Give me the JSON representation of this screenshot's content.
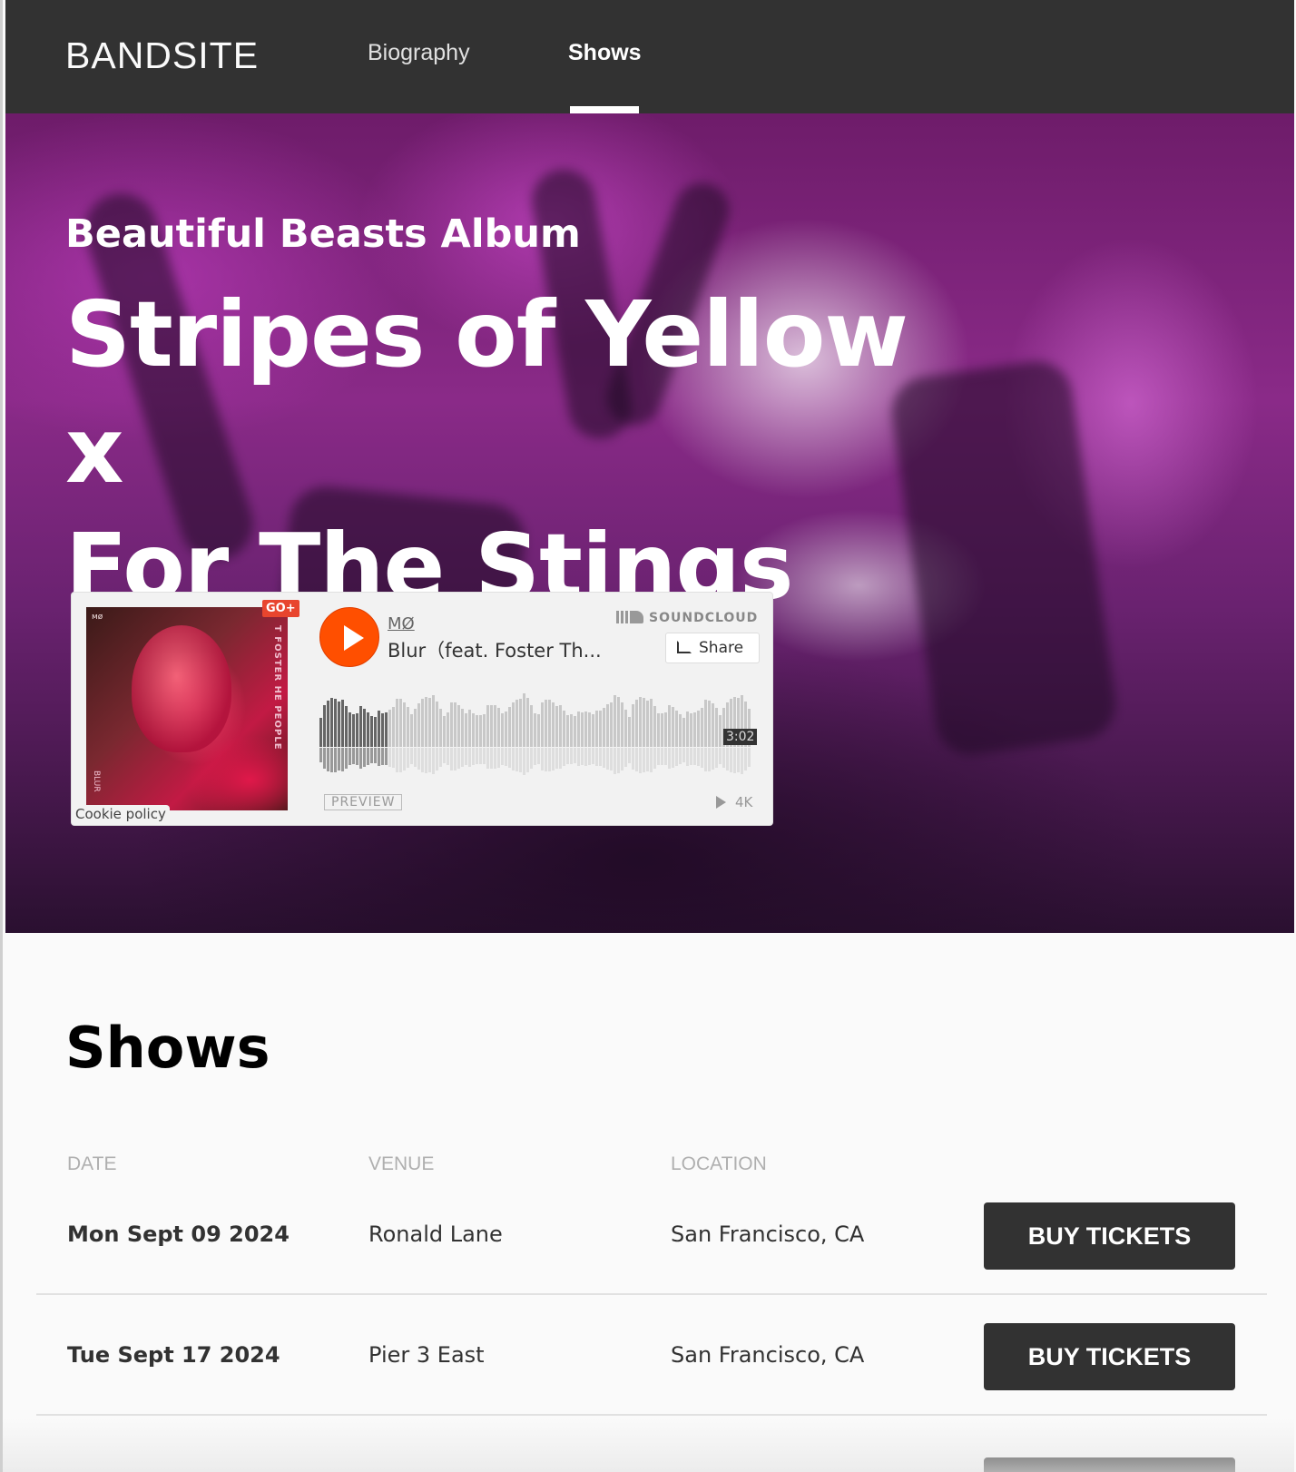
{
  "header": {
    "logo": "BANDSITE",
    "nav": [
      {
        "label": "Biography",
        "active": false
      },
      {
        "label": "Shows",
        "active": true
      }
    ]
  },
  "hero": {
    "kicker": "Beautiful Beasts Album",
    "title_line1": "Stripes of Yellow x",
    "title_line2": "For The Stings"
  },
  "soundcloud": {
    "artist": "MØ",
    "track": "Blur（feat. Foster Th...",
    "brand": "SOUNDCLOUD",
    "share_label": "Share",
    "duration": "3:02",
    "preview_label": "PREVIEW",
    "plays": "4K",
    "go_plus": "GO+",
    "cookie_policy": "Cookie policy",
    "art_side_text": "T FOSTER HE PEOPLE",
    "art_bottom_text": "BLUR",
    "played_fraction": 0.16,
    "accent": "#ff4f00"
  },
  "shows": {
    "heading": "Shows",
    "columns": {
      "date": "DATE",
      "venue": "VENUE",
      "location": "LOCATION"
    },
    "rows": [
      {
        "date": "Mon Sept 09 2024",
        "venue": "Ronald Lane",
        "location": "San Francisco, CA",
        "button": "BUY TICKETS"
      },
      {
        "date": "Tue Sept 17 2024",
        "venue": "Pier 3 East",
        "location": "San Francisco, CA",
        "button": "BUY TICKETS"
      }
    ]
  },
  "colors": {
    "header_bg": "#323232",
    "button_bg": "#323232",
    "page_bg": "#fafafa",
    "divider": "#e1e1e1",
    "muted": "#afafaf"
  }
}
